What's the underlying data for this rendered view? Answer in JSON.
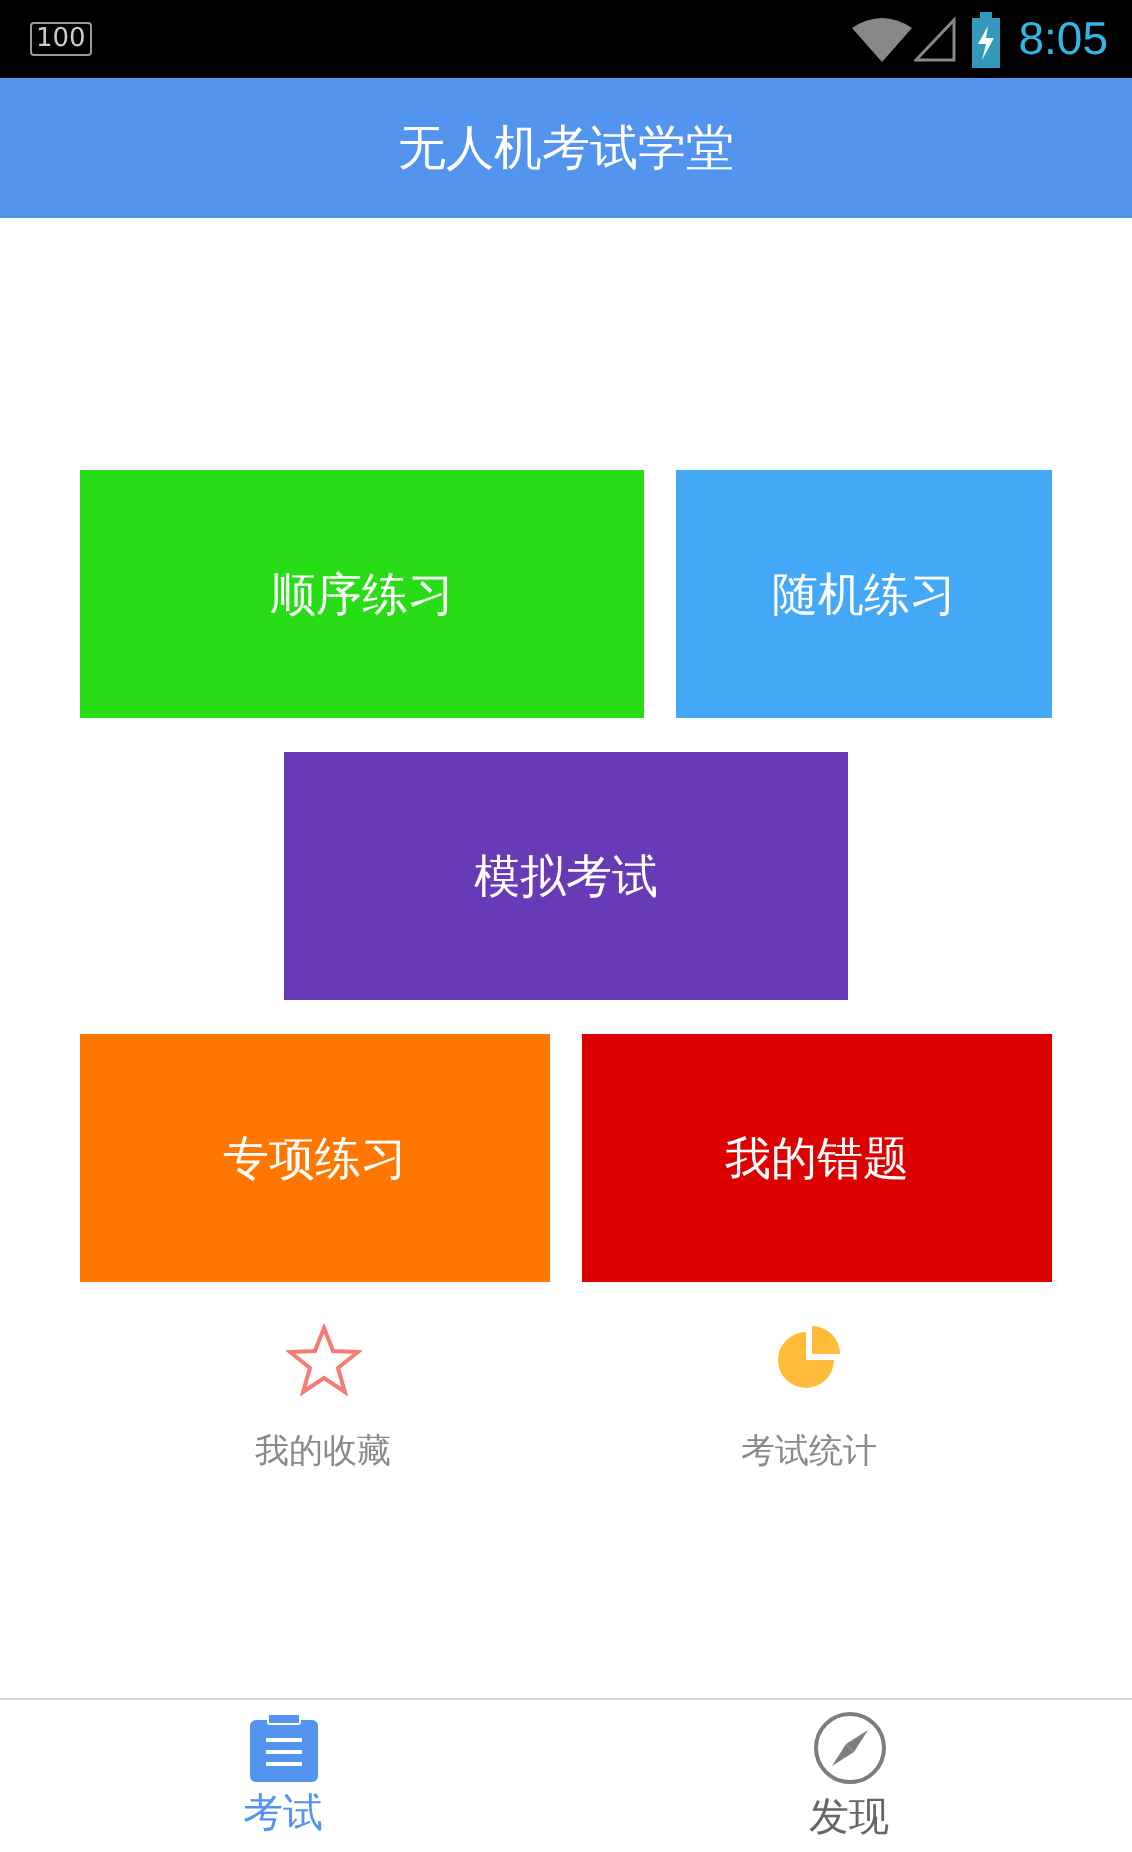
{
  "status_bar": {
    "indicator": "100",
    "time": "8:05"
  },
  "app_bar": {
    "title": "无人机考试学堂"
  },
  "tile_rows": [
    [
      {
        "label": "顺序练习",
        "color": "#28dd16"
      },
      {
        "label": "随机练习",
        "color": "#43a8f6"
      }
    ],
    [
      {
        "label": "模拟考试",
        "color": "#673bb5"
      }
    ],
    [
      {
        "label": "专项练习",
        "color": "#ff7700"
      },
      {
        "label": "我的错题",
        "color": "#dd0000"
      }
    ]
  ],
  "shortcuts": [
    {
      "kind": "star",
      "label": "我的收藏"
    },
    {
      "kind": "pie",
      "label": "考试统计"
    }
  ],
  "bottom_tabs": [
    {
      "kind": "clipboard",
      "label": "考试",
      "selected": true
    },
    {
      "kind": "compass",
      "label": "发现",
      "selected": false
    }
  ]
}
